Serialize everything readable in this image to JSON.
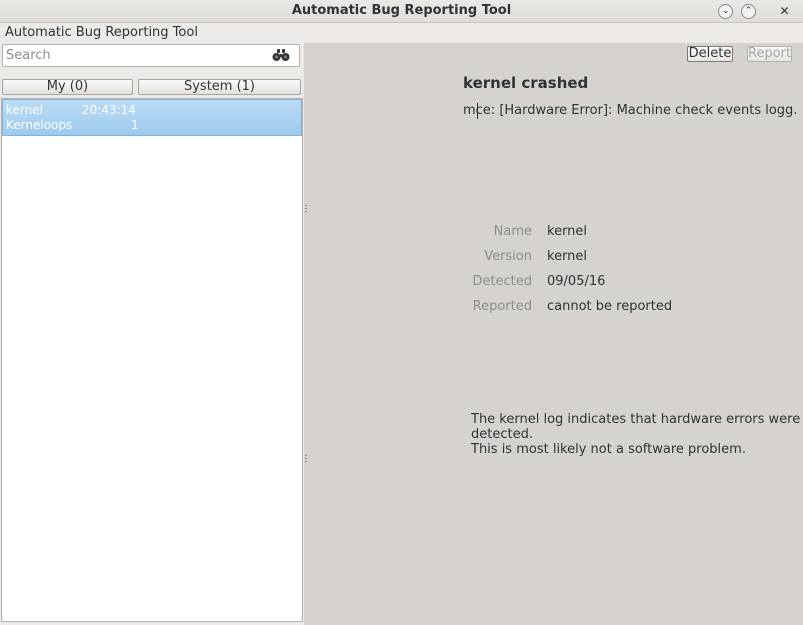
{
  "window": {
    "title": "Automatic Bug Reporting Tool",
    "controls": [
      "minimize-icon",
      "maximize-icon",
      "close-icon"
    ]
  },
  "menubar": {
    "app_label": "Automatic Bug Reporting Tool"
  },
  "search": {
    "placeholder": "Search",
    "value": "",
    "icon": "binoculars-icon"
  },
  "tabs": [
    {
      "label": "My (0)"
    },
    {
      "label": "System (1)"
    }
  ],
  "problems": [
    {
      "name": "kernel",
      "time": "20:43:14",
      "source": "Kerneloops",
      "count": "1",
      "selected": true
    }
  ],
  "actions": {
    "delete_label": "Delete",
    "report_label": "Report"
  },
  "detail": {
    "title": "kernel crashed",
    "reason": "mce: [Hardware Error]: Machine check events logg…",
    "fields": [
      {
        "label": "Name",
        "value": "kernel"
      },
      {
        "label": "Version",
        "value": "kernel"
      },
      {
        "label": "Detected",
        "value": "09/05/16"
      },
      {
        "label": "Reported",
        "value": "cannot be reported"
      }
    ],
    "explanation_line1": "The kernel log indicates that hardware errors were detected.",
    "explanation_line2": "This is most likely not a software problem."
  },
  "colors": {
    "selection": "#9ccbef",
    "window_bg": "#d6d3cf",
    "muted_text": "#8d8d8d"
  }
}
